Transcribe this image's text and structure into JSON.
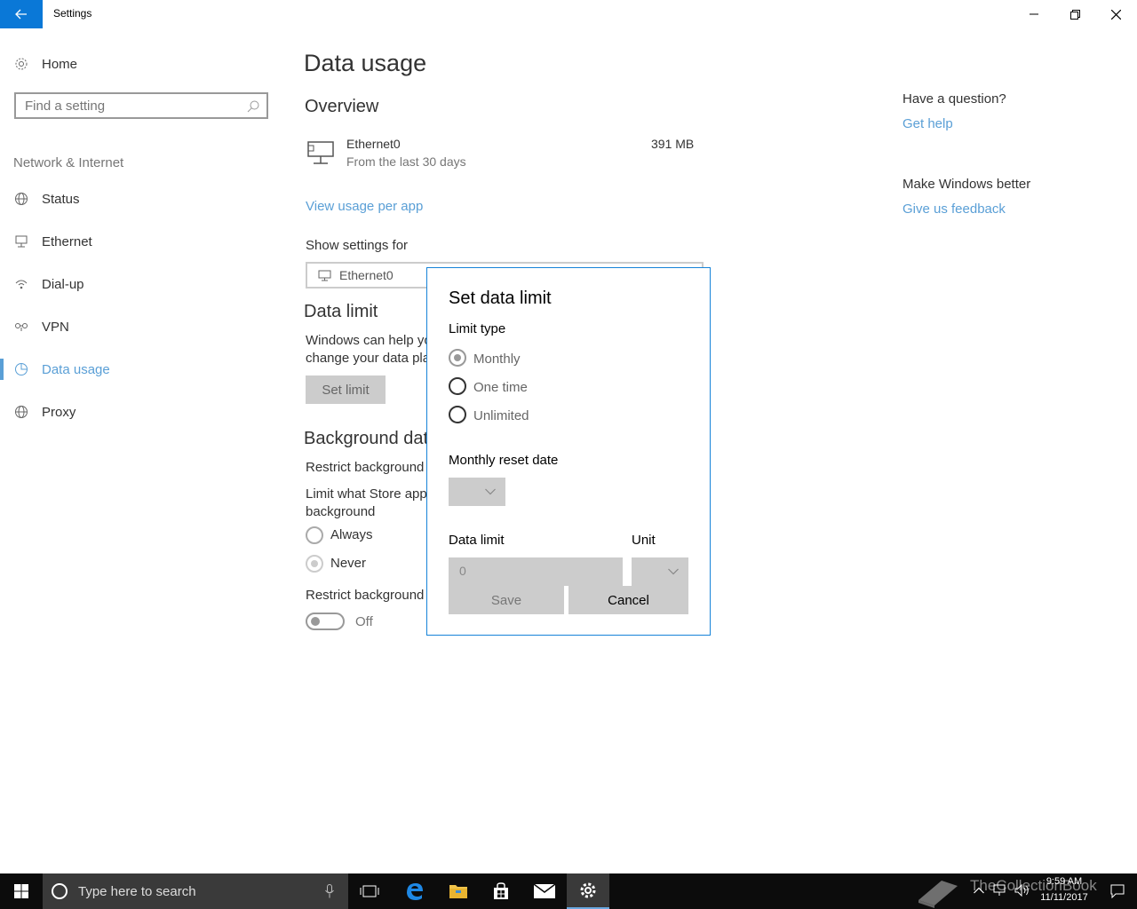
{
  "window": {
    "title": "Settings"
  },
  "sidebar": {
    "home_label": "Home",
    "search_placeholder": "Find a setting",
    "category": "Network & Internet",
    "items": [
      {
        "label": "Status",
        "icon": "globe-icon"
      },
      {
        "label": "Ethernet",
        "icon": "ethernet-icon"
      },
      {
        "label": "Dial-up",
        "icon": "dialup-icon"
      },
      {
        "label": "VPN",
        "icon": "vpn-icon"
      },
      {
        "label": "Data usage",
        "icon": "data-usage-icon",
        "active": true
      },
      {
        "label": "Proxy",
        "icon": "globe-icon"
      }
    ]
  },
  "main": {
    "title": "Data usage",
    "overview": {
      "heading": "Overview",
      "connection_name": "Ethernet0",
      "period": "From the last 30 days",
      "amount": "391 MB",
      "view_per_app": "View usage per app"
    },
    "show_settings_for": {
      "label": "Show settings for",
      "value": "Ethernet0"
    },
    "data_limit": {
      "heading": "Data limit",
      "desc_line1": "Windows can help yo",
      "desc_line2": "change your data pla",
      "set_limit_button": "Set limit"
    },
    "background_data": {
      "heading": "Background dat",
      "restrict_label": "Restrict background",
      "limit_store_line1": "Limit what Store app",
      "limit_store_line2": "background",
      "options": [
        "Always",
        "Never"
      ],
      "selected": "Never",
      "restrict_toggle_label": "Restrict background",
      "toggle_state": "Off"
    }
  },
  "right_pane": {
    "question": "Have a question?",
    "get_help": "Get help",
    "make_better": "Make Windows better",
    "feedback": "Give us feedback"
  },
  "dialog": {
    "title": "Set data limit",
    "limit_type_label": "Limit type",
    "options": [
      "Monthly",
      "One time",
      "Unlimited"
    ],
    "selected": "Monthly",
    "reset_date_label": "Monthly reset date",
    "data_limit_label": "Data limit",
    "unit_label": "Unit",
    "data_limit_value": "0",
    "save_button": "Save",
    "cancel_button": "Cancel"
  },
  "taskbar": {
    "search_placeholder": "Type here to search",
    "time": "9:59 AM",
    "date": "11/11/2017",
    "watermark": "TheCollectionBook"
  },
  "colors": {
    "accent": "#0a78d7",
    "link": "#5a9fd6",
    "dialog_border": "#1683d8",
    "taskbar": "#0c0c0c"
  }
}
